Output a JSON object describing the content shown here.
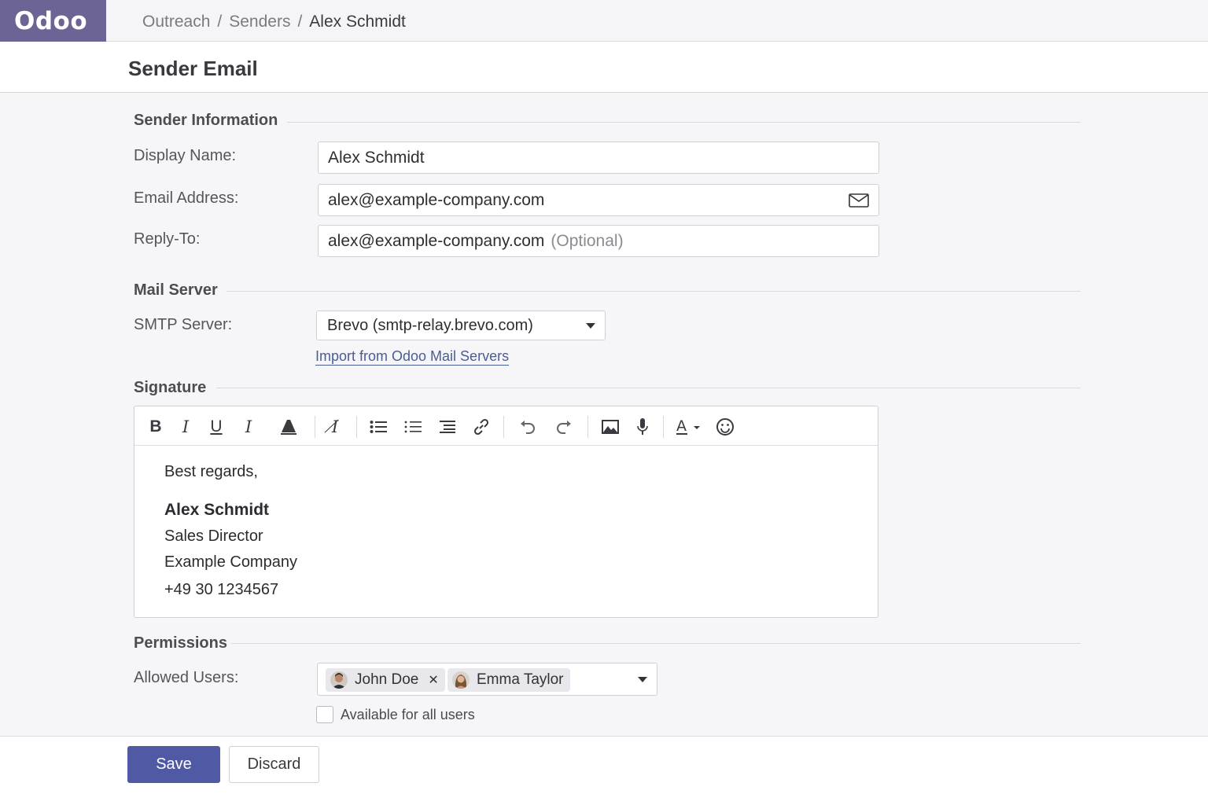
{
  "app": {
    "brand": "Odoo"
  },
  "breadcrumb": {
    "items": [
      "Outreach",
      "Senders"
    ],
    "current": "Alex Schmidt",
    "separator": "/"
  },
  "page": {
    "title": "Sender Email"
  },
  "sender_info": {
    "section_title": "Sender Information",
    "display_name_label": "Display Name:",
    "display_name_value": "Alex Schmidt",
    "email_label": "Email Address:",
    "email_value": "alex@example-company.com",
    "reply_to_label": "Reply-To:",
    "reply_to_value": "alex@example-company.com",
    "reply_to_hint": "(Optional)"
  },
  "mail_server": {
    "section_title": "Mail Server",
    "smtp_label": "SMTP Server:",
    "smtp_value": "Brevo (smtp-relay.brevo.com)",
    "import_link": "Import from Odoo Mail Servers"
  },
  "signature": {
    "section_title": "Signature",
    "toolbar_icons": [
      "bold-icon",
      "italic-icon",
      "underline-icon",
      "italic-alt-icon",
      "highlight-icon",
      "clear-format-icon",
      "bullet-list-icon",
      "list-icon",
      "indent-list-icon",
      "link-icon",
      "undo-icon",
      "redo-icon",
      "image-icon",
      "microphone-icon",
      "font-color-icon",
      "emoji-icon"
    ],
    "lines": {
      "greeting": "Best regards,",
      "name": "Alex Schmidt",
      "title": "Sales Director",
      "company": "Example Company",
      "phone": "+49 30 1234567"
    }
  },
  "permissions": {
    "section_title": "Permissions",
    "allowed_users_label": "Allowed Users:",
    "users": [
      {
        "name": "John Doe"
      },
      {
        "name": "Emma Taylor"
      }
    ],
    "all_users_checkbox_label": "Available for all users",
    "all_users_checked": false
  },
  "footer": {
    "save_label": "Save",
    "discard_label": "Discard"
  },
  "colors": {
    "brand": "#6b6494",
    "primary": "#5059a4",
    "link": "#4a5c96"
  }
}
